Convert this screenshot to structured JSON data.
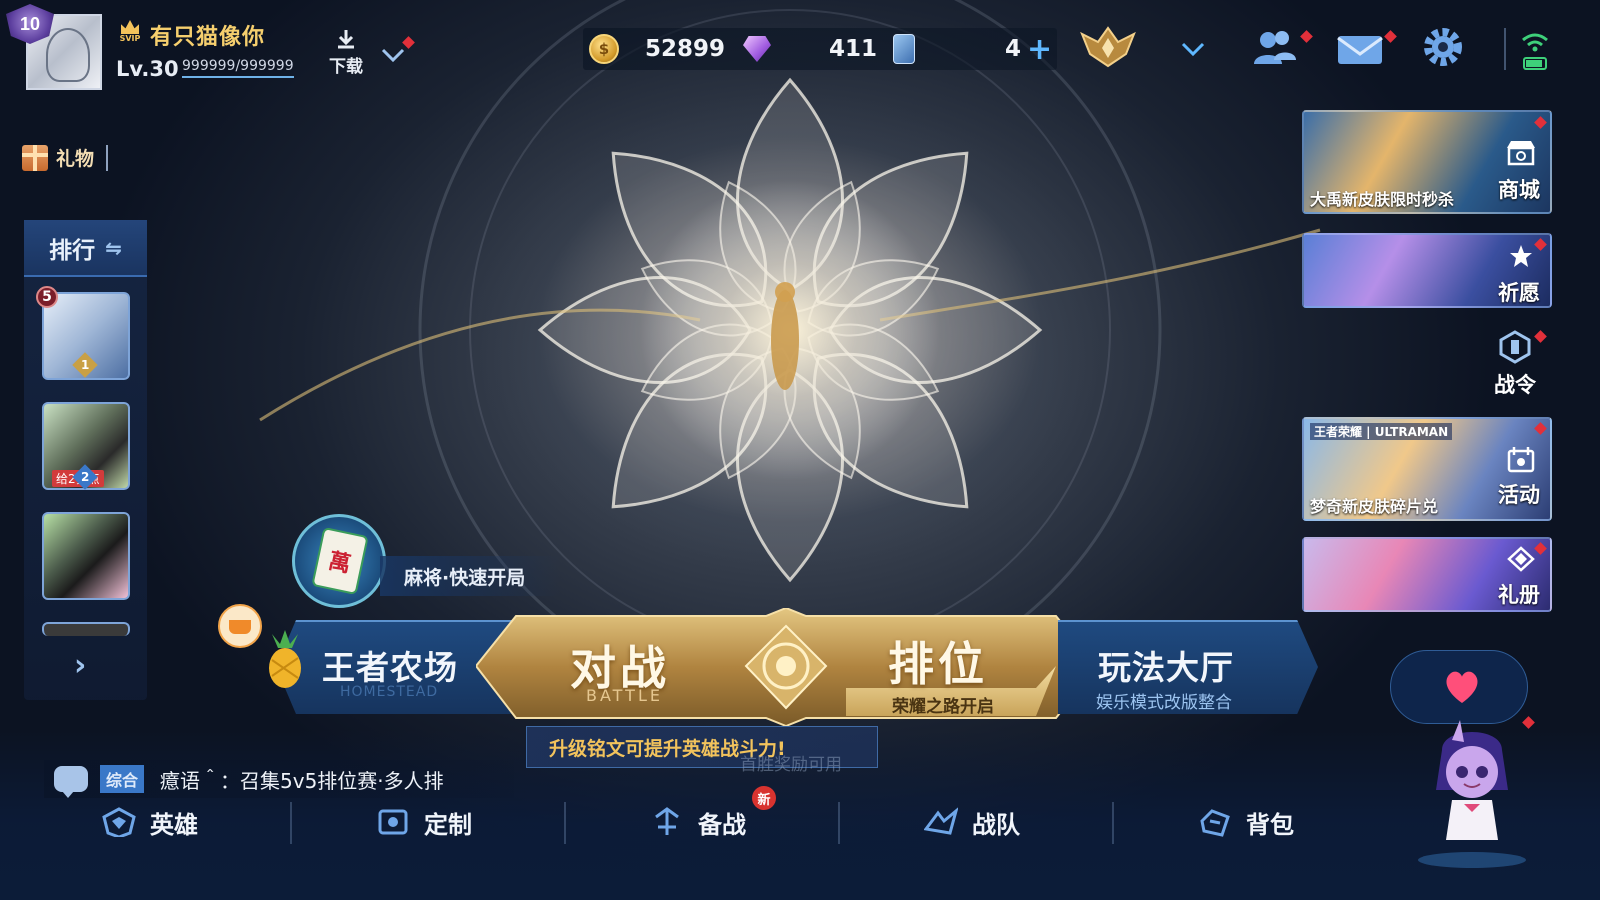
{
  "profile": {
    "vip_level": "10",
    "vip_tag": "SVIP",
    "name": "有只猫像你",
    "level": "Lv.30",
    "exp": "999999/999999",
    "download_label": "下载"
  },
  "resources": {
    "gold": "52899",
    "diamonds": "411",
    "tickets": "4"
  },
  "top_icons": [
    "friends-icon",
    "mail-icon",
    "settings-icon",
    "wifi-icon",
    "battery-icon"
  ],
  "gift": {
    "label": "礼物"
  },
  "ranking": {
    "header": "排行",
    "friends": [
      {
        "rank": "5",
        "num": "1"
      },
      {
        "tag": "给2赞点",
        "num": "2"
      },
      {}
    ]
  },
  "right_panel": {
    "shop": {
      "label": "商城",
      "caption": "大禹新皮肤限时秒杀"
    },
    "wish": {
      "label": "祈愿"
    },
    "battlepass": {
      "label": "战令"
    },
    "event": {
      "label": "活动",
      "caption": "梦奇新皮肤碎片兑",
      "tag": "王者荣耀 | ULTRAMAN"
    },
    "album": {
      "label": "礼册"
    }
  },
  "modes": {
    "mahjong": {
      "label": "麻将·快速开局",
      "tile_text": "萬"
    },
    "farm": {
      "title": "王者农场",
      "subtitle": "HOMESTEAD"
    },
    "battle": {
      "title": "对战",
      "subtitle": "BATTLE"
    },
    "ranked": {
      "title": "排位",
      "subtitle": "荣耀之路开启"
    },
    "hall": {
      "title": "玩法大厅",
      "subtitle": "娱乐模式改版整合"
    }
  },
  "tip": {
    "text": "升级铭文可提升英雄战斗力!",
    "ghost": "首胜奖励可用"
  },
  "chat": {
    "channel": "综合",
    "message": "癔语＾：召集5v5排位赛·多人排"
  },
  "nav": [
    {
      "label": "英雄",
      "icon": "hero-icon"
    },
    {
      "label": "定制",
      "icon": "custom-icon"
    },
    {
      "label": "备战",
      "icon": "prepare-icon",
      "badge": "新"
    },
    {
      "label": "战队",
      "icon": "team-icon"
    },
    {
      "label": "背包",
      "icon": "bag-icon"
    }
  ],
  "colors": {
    "gold_accent": "#f6cf6e",
    "panel_blue": "#1f4a80",
    "battle_gold": "#c9a45a",
    "red_dot": "#e2303a"
  }
}
